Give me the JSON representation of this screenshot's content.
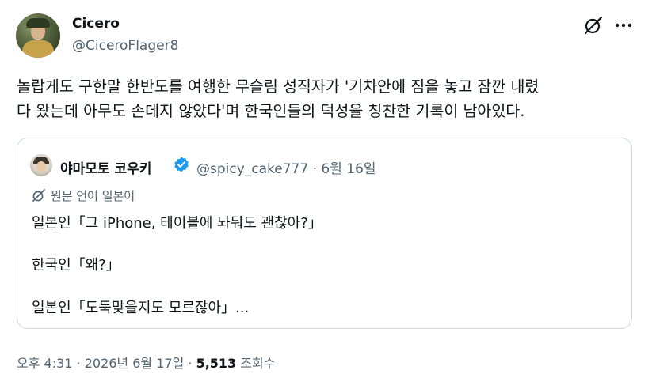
{
  "author": {
    "name": "Cicero",
    "handle": "@CiceroFlager8",
    "avatar_icon": "avatar"
  },
  "header_actions": {
    "grok_icon": "grok-icon",
    "more_icon": "more-options-icon"
  },
  "tweet": {
    "line1": "놀랍게도 구한말 한반도를 여행한 무슬림 성직자가 '기차안에 짐을 놓고 잠깐 내렸",
    "line2": "다 왔는데 아무도 손데지 않았다'며 한국인들의 덕성을 칭찬한 기록이 남아있다."
  },
  "quote": {
    "name": "야마모토 코우키",
    "handle_date": "@spicy_cake777 · 6월 16일",
    "translate_label": "원문 언어 일본어",
    "lines": [
      "일본인「그 iPhone, 테이블에 놔둬도 괜찮아?」",
      "한국인「왜?」",
      "일본인「도둑맞을지도 모르잖아」..."
    ]
  },
  "meta": {
    "time_date": "오후 4:31 · 2026년 6월 17일 · ",
    "views_count": "5,513",
    "views_label": " 조회수"
  },
  "colors": {
    "text": "#0f1419",
    "secondary": "#536471",
    "border": "#cfd9de",
    "verified": "#1d9bf0"
  }
}
